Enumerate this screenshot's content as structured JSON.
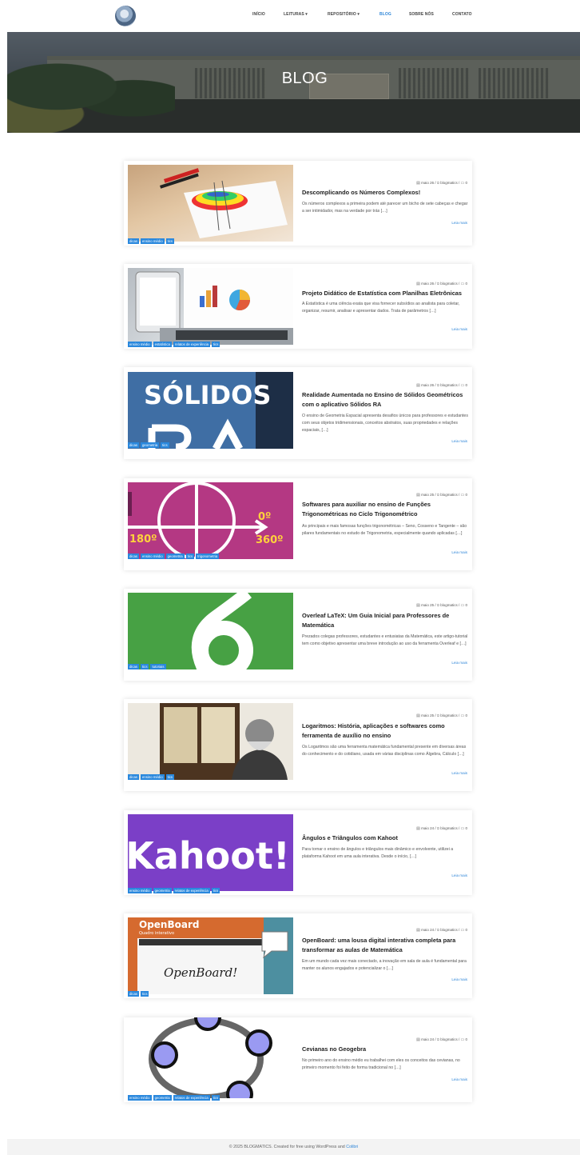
{
  "nav": {
    "items": [
      "INÍCIO",
      "LEITURAS ▾",
      "REPOSITÓRIO ▾",
      "BLOG",
      "SOBRE NÓS",
      "CONTATO"
    ],
    "active": "BLOG"
  },
  "hero": {
    "title": "BLOG"
  },
  "posts": [
    {
      "date": "maio 26",
      "author": "blogmatics",
      "comments": "0",
      "title": "Descomplicando os Números Complexos!",
      "excerpt": "Os números complexos a primeira podem até parecer um bicho de sete cabeças e chegar a ser intimidador, mas na verdade por trás […]",
      "read_more": "Leia mais",
      "tags": [
        "dicas",
        "ensino médio",
        "tics"
      ]
    },
    {
      "date": "maio 26",
      "author": "blogmatics",
      "comments": "0",
      "title": "Projeto Didático de Estatística com Planilhas Eletrônicas",
      "excerpt": "A Estatística é uma ciência exata que visa fornecer subsídios ao analista para coletar, organizar, resumir, analisar e apresentar dados. Trata de parâmetros […]",
      "read_more": "Leia mais",
      "tags": [
        "ensino médio",
        "estatística",
        "relatos de experiência",
        "tics"
      ]
    },
    {
      "date": "maio 26",
      "author": "blogmatics",
      "comments": "0",
      "title": "Realidade Aumentada no Ensino de Sólidos Geométricos com o aplicativo Sólidos RA",
      "excerpt": "O ensino de Geometria Espacial apresenta desafios únicos para professores e estudantes com seus objetos tridimensionais, conceitos abstratos, suas propriedades e relações espaciais, […]",
      "read_more": "Leia mais",
      "tags": [
        "dicas",
        "geometria",
        "tics"
      ]
    },
    {
      "date": "maio 25",
      "author": "blogmatics",
      "comments": "0",
      "title": "Softwares para auxiliar no ensino de Funções Trigonométricas no Ciclo Trigonométrico",
      "excerpt": "As principais e mais famosas funções trigonométricas – Seno, Cosseno e Tangente – são pilares fundamentais no estudo de Trigonometria, especialmente quando aplicadas […]",
      "read_more": "Leia mais",
      "tags": [
        "dicas",
        "ensino médio",
        "geometria",
        "tics",
        "trigonometria"
      ]
    },
    {
      "date": "maio 25",
      "author": "blogmatics",
      "comments": "0",
      "title": "Overleaf LaTeX: Um Guia Inicial para Professores de Matemática",
      "excerpt": "Prezados colegas professores, estudantes e entusiatas da Matemática, este artigo-tutorial tem como objetivo apresentar uma breve introdução ao uso da ferramenta Overleaf e […]",
      "read_more": "Leia mais",
      "tags": [
        "dicas",
        "tics",
        "tutoriais"
      ]
    },
    {
      "date": "maio 25",
      "author": "blogmatics",
      "comments": "0",
      "title": "Logaritmos: História, aplicações e softwares como ferramenta de auxílio no ensino",
      "excerpt": "Os Logaritmos são uma ferramenta matemática fundamental presente em diversas áreas do conhecimento e do cotidiano, usada em várias disciplinas como Álgebra, Cálculo […]",
      "read_more": "Leia mais",
      "tags": [
        "dicas",
        "ensino médio",
        "tics"
      ]
    },
    {
      "date": "maio 24",
      "author": "blogmatics",
      "comments": "0",
      "title": "Ângulos e Triângulos com Kahoot",
      "excerpt": "Para tornar o ensino de ângulos e triângulos mais dinâmico e envolvente, utilizei a plataforma Kahoot em uma aula interativa. Desde o início, […]",
      "read_more": "Leia mais",
      "tags": [
        "ensino médio",
        "geometria",
        "relatos de experiência",
        "tics"
      ]
    },
    {
      "date": "maio 24",
      "author": "blogmatics",
      "comments": "0",
      "title": "OpenBoard: uma lousa digital interativa completa para transformar as aulas de Matemática",
      "excerpt": "Em um mundo cada vez mais conectado, a inovação em sala de aula é fundamental para manter os alunos engajados e potencializar o […]",
      "read_more": "Leia mais",
      "tags": [
        "dicas",
        "tics"
      ]
    },
    {
      "date": "maio 24",
      "author": "blogmatics",
      "comments": "0",
      "title": "Cevianas no Geogebra",
      "excerpt": "No primeiro ano do ensino médio eu trabalhei com eles os conceitos das cevianas, no primeiro momento foi feito de forma tradicional no […]",
      "read_more": "Leia mais",
      "tags": [
        "ensino médio",
        "geometria",
        "relatos de experiência",
        "tics"
      ]
    }
  ],
  "thumbs": {
    "solidos": "SÓLIDOS",
    "deg180": "180º",
    "deg0": "0º",
    "deg360": "360º",
    "kahoot": "Kahoot!",
    "openboard_title": "OpenBoard",
    "openboard_sub": "Quadro interativo",
    "openboard_script": "OpenBoard!"
  },
  "footer": {
    "text": "© 2025 BLOGMATICS. Created for free using WordPress and",
    "link": "Colibri"
  },
  "colors": {
    "accent": "#2f86d8",
    "tag": "#2a88dd"
  }
}
